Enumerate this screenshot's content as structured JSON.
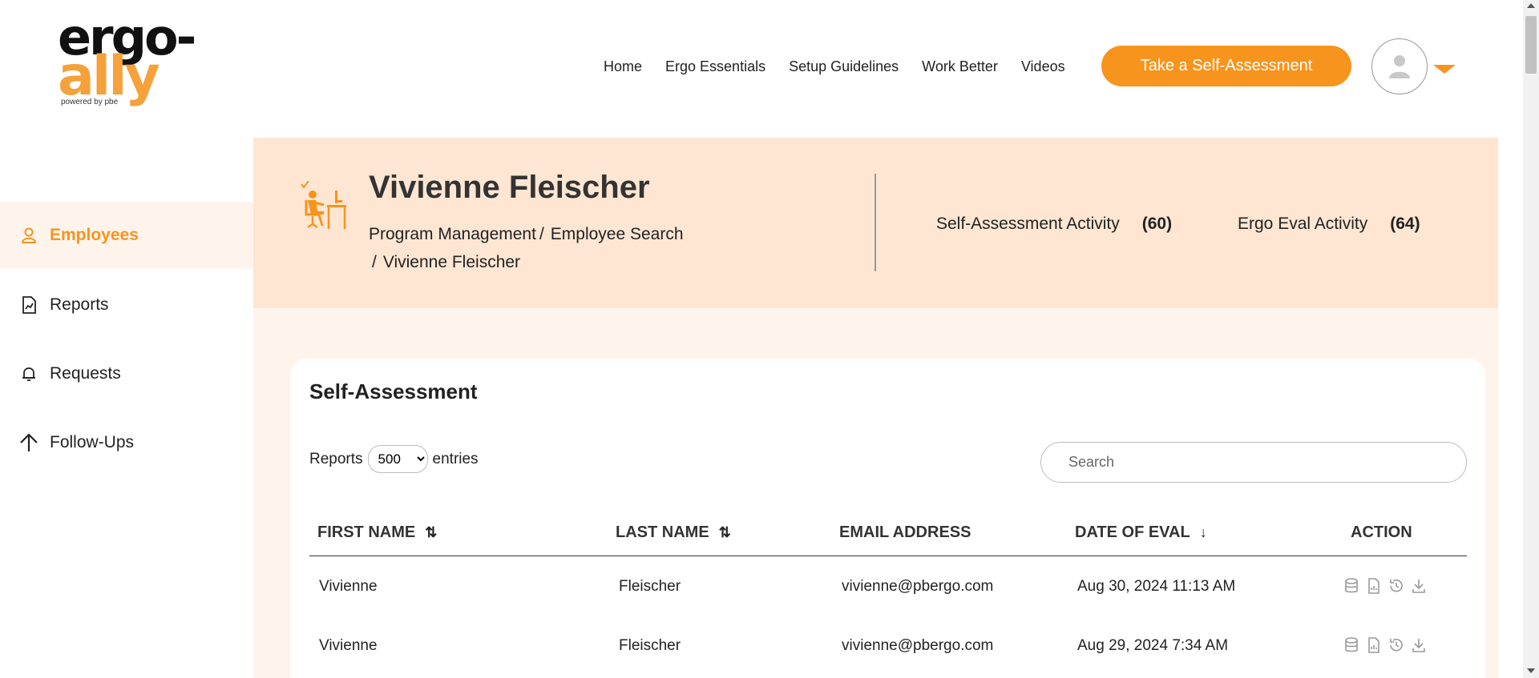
{
  "logo": {
    "line1": "ergo-",
    "line2": "ally",
    "tagline": "powered by pbe"
  },
  "nav": {
    "items": [
      "Home",
      "Ergo Essentials",
      "Setup Guidelines",
      "Work Better",
      "Videos"
    ]
  },
  "cta": {
    "label": "Take a Self-Assessment"
  },
  "colors": {
    "accent": "#f7941d",
    "banner": "#fee6d2",
    "background": "#fff4ec"
  },
  "sidebar": {
    "items": [
      {
        "label": "Employees",
        "icon": "user-icon",
        "active": true
      },
      {
        "label": "Reports",
        "icon": "report-icon",
        "active": false
      },
      {
        "label": "Requests",
        "icon": "bell-icon",
        "active": false
      },
      {
        "label": "Follow-Ups",
        "icon": "arrow-up-icon",
        "active": false
      }
    ]
  },
  "banner": {
    "name": "Vivienne Fleischer",
    "breadcrumb": [
      "Program Management",
      "Employee Search",
      "Vivienne Fleischer"
    ],
    "sep": "/",
    "self_assessment": {
      "label": "Self-Assessment Activity",
      "count": "(60)"
    },
    "ergo_eval": {
      "label": "Ergo Eval Activity",
      "count": "(64)"
    }
  },
  "table": {
    "title": "Self-Assessment",
    "length_prefix": "Reports",
    "length_value": "500",
    "length_suffix": "entries",
    "search_placeholder": "Search",
    "columns": [
      "FIRST NAME",
      "LAST NAME",
      "EMAIL ADDRESS",
      "DATE OF EVAL",
      "ACTION"
    ],
    "rows": [
      {
        "first": "Vivienne",
        "last": "Fleischer",
        "email": "vivienne@pbergo.com",
        "date": "Aug 30, 2024 11:13 AM"
      },
      {
        "first": "Vivienne",
        "last": "Fleischer",
        "email": "vivienne@pbergo.com",
        "date": "Aug 29, 2024 7:34 AM"
      }
    ],
    "action_icons": [
      "database-icon",
      "document-icon",
      "history-icon",
      "download-icon"
    ]
  }
}
